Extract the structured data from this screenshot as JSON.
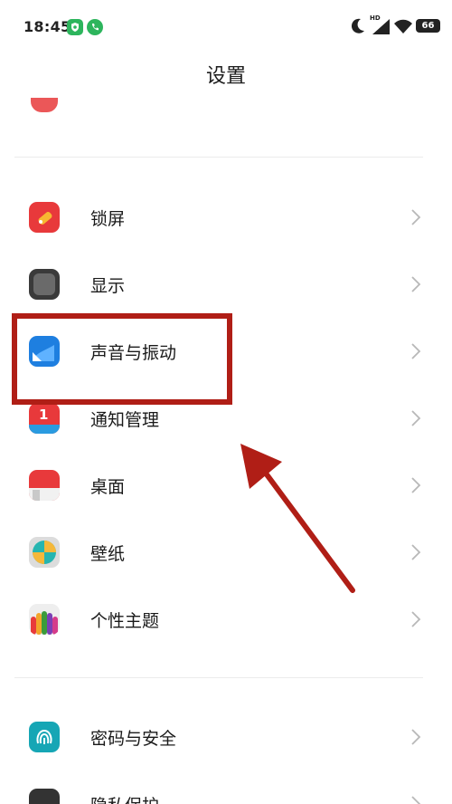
{
  "status_bar": {
    "time": "18:45",
    "hd_label": "HD",
    "battery_level": "66"
  },
  "page_title": "设置",
  "settings_items": [
    {
      "label": "锁屏",
      "icon": "lock-screen-icon",
      "color": "#e8393b"
    },
    {
      "label": "显示",
      "icon": "display-icon",
      "color": "#444444"
    },
    {
      "label": "声音与振动",
      "icon": "sound-vibration-icon",
      "color": "#1e7fe0"
    },
    {
      "label": "通知管理",
      "icon": "notification-icon",
      "color": "#e8393b"
    },
    {
      "label": "桌面",
      "icon": "desktop-icon",
      "color": "#e8393b"
    },
    {
      "label": "壁纸",
      "icon": "wallpaper-icon",
      "color": "#26b5b0"
    },
    {
      "label": "个性主题",
      "icon": "theme-icon",
      "color": "#7a3fb5"
    },
    {
      "label": "密码与安全",
      "icon": "password-security-icon",
      "color": "#16a6b5"
    },
    {
      "label": "隐私保护",
      "icon": "privacy-icon",
      "color": "#333333"
    }
  ],
  "notification_badge": "1",
  "annotation_color": "#b01e16"
}
